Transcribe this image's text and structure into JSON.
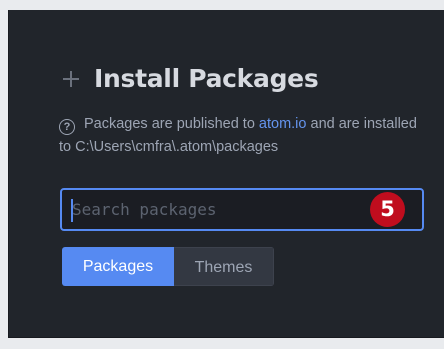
{
  "header": {
    "icon": "plus-icon",
    "title": "Install Packages"
  },
  "info": {
    "icon": "question-circle-icon",
    "text_before": "Packages are published to ",
    "link_text": "atom.io",
    "text_after": " and are installed to C:\\Users\\cmfra\\.atom\\packages"
  },
  "search": {
    "placeholder": "Search packages",
    "value": "",
    "badge": "5"
  },
  "tabs": [
    {
      "label": "Packages",
      "active": true
    },
    {
      "label": "Themes",
      "active": false
    }
  ],
  "colors": {
    "panel_bg": "#21252b",
    "accent": "#568af2",
    "badge": "#c00d1e",
    "link": "#6494ed"
  }
}
